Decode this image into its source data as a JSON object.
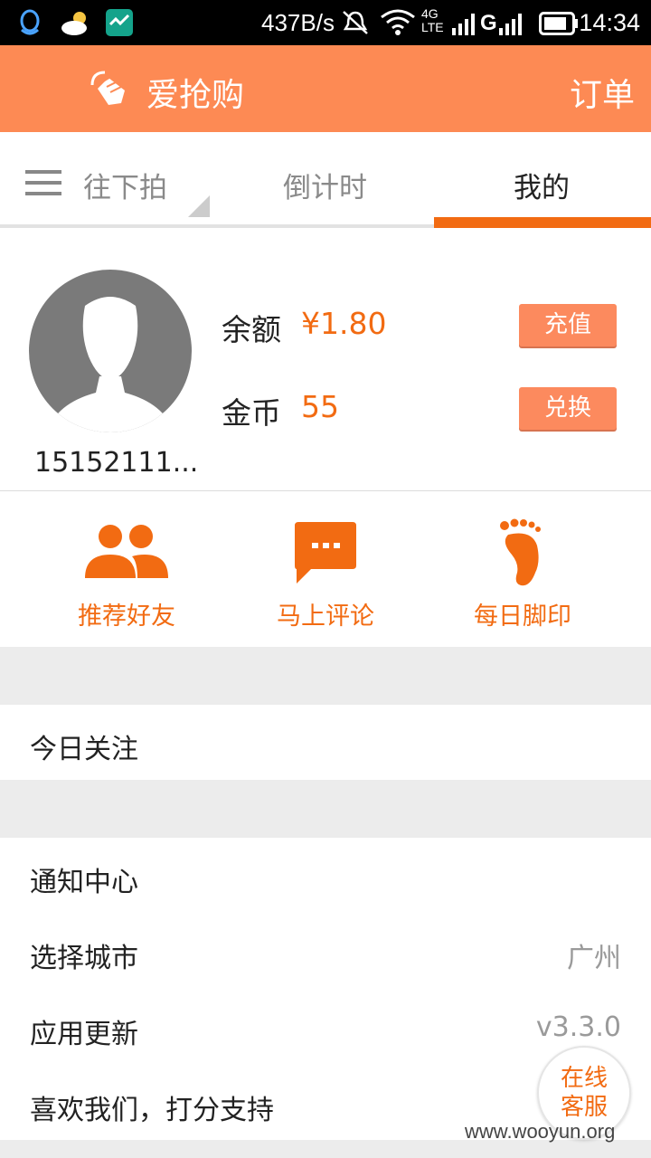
{
  "status_bar": {
    "network_speed": "437B/s",
    "network_type": "4G LTE",
    "sim2_type": "G",
    "time": "14:34",
    "icons": [
      "qq-icon",
      "weather-icon",
      "app-icon",
      "mute-icon",
      "wifi-icon",
      "signal-icon",
      "battery-icon"
    ]
  },
  "app_bar": {
    "title": "爱抢购",
    "orders_label": "订单",
    "logo_icon": "hand-clap-icon"
  },
  "tabs": [
    {
      "label": "往下拍",
      "active": false
    },
    {
      "label": "倒计时",
      "active": false
    },
    {
      "label": "我的",
      "active": true
    }
  ],
  "profile": {
    "username": "15152111...",
    "balance_label": "余额",
    "balance_value": "¥1.80",
    "recharge_label": "充值",
    "coins_label": "金币",
    "coins_value": "55",
    "exchange_label": "兑换"
  },
  "actions": [
    {
      "label": "推荐好友",
      "icon": "friends-icon"
    },
    {
      "label": "马上评论",
      "icon": "comment-icon"
    },
    {
      "label": "每日脚印",
      "icon": "footprint-icon"
    }
  ],
  "menu": {
    "today_focus": "今日关注",
    "items": [
      {
        "label": "通知中心",
        "value": ""
      },
      {
        "label": "选择城市",
        "value": "广州"
      },
      {
        "label": "应用更新",
        "value": "v3.3.0"
      },
      {
        "label": "喜欢我们，打分支持",
        "value": ""
      }
    ]
  },
  "customer_service": {
    "line1": "在线",
    "line2": "客服"
  },
  "watermark": "www.wooyun.org",
  "colors": {
    "accent": "#f26b12",
    "header": "#fd8a54",
    "button": "#fc8a5e"
  }
}
